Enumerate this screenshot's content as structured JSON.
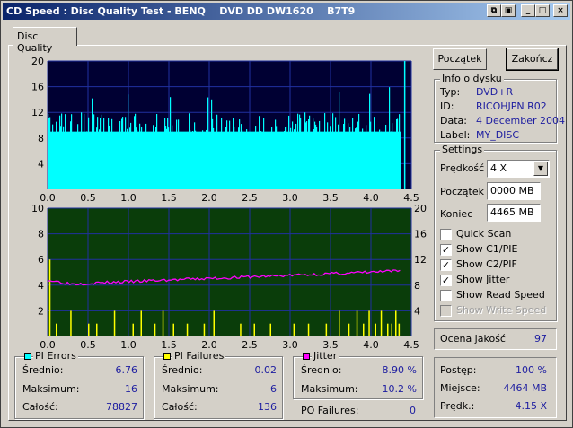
{
  "window": {
    "title": "CD Speed : Disc Quality Test - BENQ    DVD DD DW1620    B7T9"
  },
  "tabs": [
    {
      "label": "Disc Quality"
    }
  ],
  "buttons": {
    "start": "Początek",
    "stop": "Zakończ"
  },
  "disc_info": {
    "title": "Info o dysku",
    "type_label": "Typ:",
    "type": "DVD+R",
    "id_label": "ID:",
    "id": "RICOHJPN R02",
    "date_label": "Data:",
    "date": "4 December 2004",
    "label_label": "Label:",
    "label": "MY_DISC"
  },
  "settings": {
    "title": "Settings",
    "speed_label": "Prędkość",
    "speed": "4 X",
    "start_label": "Początek",
    "start": "0000 MB",
    "end_label": "Koniec",
    "end": "4465 MB",
    "checks": [
      {
        "label": "Quick Scan",
        "checked": false,
        "disabled": false
      },
      {
        "label": "Show C1/PIE",
        "checked": true,
        "disabled": false
      },
      {
        "label": "Show C2/PIF",
        "checked": true,
        "disabled": false
      },
      {
        "label": "Show Jitter",
        "checked": true,
        "disabled": false
      },
      {
        "label": "Show Read Speed",
        "checked": false,
        "disabled": false
      },
      {
        "label": "Show Write Speed",
        "checked": false,
        "disabled": true
      }
    ]
  },
  "quality": {
    "label": "Ocena jakość",
    "value": "97"
  },
  "progress": {
    "progress_label": "Postęp:",
    "progress": "100 %",
    "position_label": "Miejsce:",
    "position": "4464 MB",
    "speed_label": "Prędk.:",
    "speed": "4.15 X"
  },
  "pi_errors": {
    "title": "PI Errors",
    "avg_label": "Średnio:",
    "avg": "6.76",
    "max_label": "Maksimum:",
    "max": "16",
    "total_label": "Całość:",
    "total": "78827",
    "color": "#00ffff"
  },
  "pi_failures": {
    "title": "PI Failures",
    "avg_label": "Średnio:",
    "avg": "0.02",
    "max_label": "Maksimum:",
    "max": "6",
    "total_label": "Całość:",
    "total": "136",
    "color": "#ffff00"
  },
  "jitter": {
    "title": "Jitter",
    "avg_label": "Średnio:",
    "avg": "8.90 %",
    "max_label": "Maksimum:",
    "max": "10.2 %",
    "color": "#ff00ff"
  },
  "po_failures": {
    "label": "PO Failures:",
    "value": "0"
  },
  "chart_data": [
    {
      "type": "bar",
      "x_ticks": [
        "0.0",
        "0.5",
        "1.0",
        "1.5",
        "2.0",
        "2.5",
        "3.0",
        "3.5",
        "4.0",
        "4.5"
      ],
      "y_ticks": [
        "4",
        "8",
        "12",
        "16",
        "20"
      ],
      "xlim": [
        0,
        4.5
      ],
      "ylim": [
        0,
        20
      ],
      "grid": true,
      "series": [
        {
          "color": "#00ffff",
          "baseline": 9,
          "typical_peak": 12,
          "max": 16,
          "x_end": 4.36,
          "spike_x": 4.41,
          "spike_y": 20
        }
      ]
    },
    {
      "type": "bar",
      "x_ticks": [
        "0.0",
        "0.5",
        "1.0",
        "1.5",
        "2.0",
        "2.5",
        "3.0",
        "3.5",
        "4.0",
        "4.5"
      ],
      "y_ticks_left": [
        "2",
        "4",
        "6",
        "8",
        "10"
      ],
      "y_ticks_right": [
        "4",
        "8",
        "12",
        "16",
        "20"
      ],
      "xlim": [
        0,
        4.5
      ],
      "ylim_left": [
        0,
        10
      ],
      "ylim_right": [
        0,
        20
      ],
      "grid": true,
      "series": [
        {
          "color": "#ffff00",
          "bars": [
            [
              0.02,
              6
            ],
            [
              0.1,
              1
            ],
            [
              0.28,
              2
            ],
            [
              0.5,
              1
            ],
            [
              0.6,
              1
            ],
            [
              0.82,
              2
            ],
            [
              1.05,
              1
            ],
            [
              1.15,
              2
            ],
            [
              1.32,
              1
            ],
            [
              1.42,
              2
            ],
            [
              1.55,
              1
            ],
            [
              1.72,
              1
            ],
            [
              1.93,
              1
            ],
            [
              2.05,
              2
            ],
            [
              2.38,
              1
            ],
            [
              2.55,
              1
            ],
            [
              2.75,
              1
            ],
            [
              3.04,
              1
            ],
            [
              3.22,
              1
            ],
            [
              3.44,
              1
            ],
            [
              3.6,
              2
            ],
            [
              3.72,
              1
            ],
            [
              3.82,
              2
            ],
            [
              3.9,
              1
            ],
            [
              3.97,
              2
            ],
            [
              4.05,
              1
            ],
            [
              4.12,
              2
            ],
            [
              4.2,
              1
            ],
            [
              4.25,
              1
            ],
            [
              4.3,
              2
            ],
            [
              4.34,
              1
            ]
          ]
        },
        {
          "color": "#ff00ff",
          "axis": "right",
          "start": 8.8,
          "dip": 8.2,
          "end": 10.2,
          "x_end": 4.36
        }
      ]
    }
  ]
}
